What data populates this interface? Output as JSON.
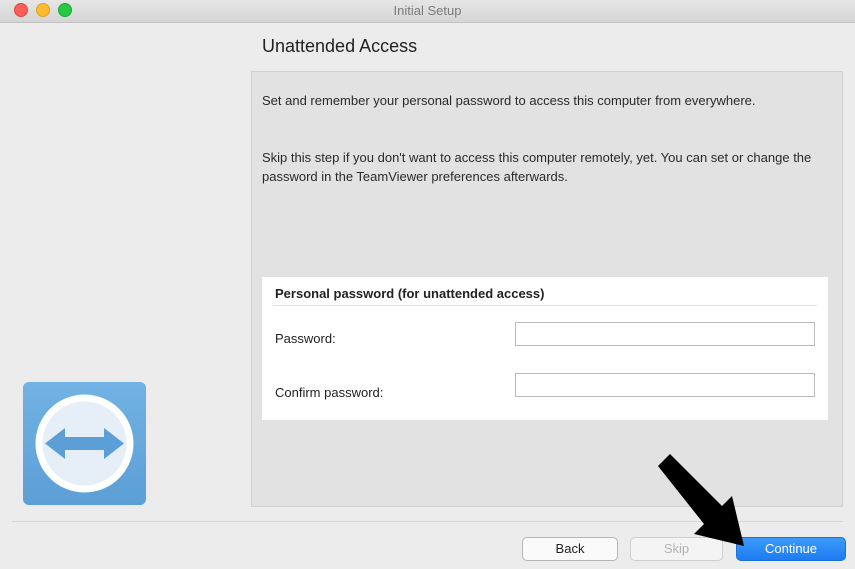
{
  "window": {
    "title": "Initial Setup",
    "colors": {
      "close": "#fc5f57",
      "minimize": "#fdbc2e",
      "zoom": "#28c840"
    }
  },
  "page": {
    "heading": "Unattended Access",
    "description_1": "Set and remember your personal password to access this computer from everywhere.",
    "description_2": "Skip this step if you don't want to access this computer remotely, yet. You can set or change the password in the TeamViewer preferences afterwards."
  },
  "form": {
    "title": "Personal password (for unattended access)",
    "password_label": "Password:",
    "password_value": "",
    "confirm_label": "Confirm password:",
    "confirm_value": ""
  },
  "logo": {
    "icon": "teamviewer-logo",
    "color": "#5c9fd6"
  },
  "buttons": {
    "back": "Back",
    "skip": "Skip",
    "continue": "Continue",
    "accent_color": "#1d7cf2"
  },
  "annotation": {
    "icon": "pointer-arrow-icon",
    "color": "#000000"
  }
}
